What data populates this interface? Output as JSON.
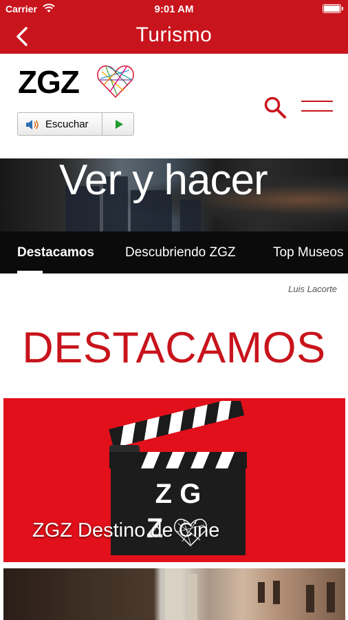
{
  "status_bar": {
    "carrier": "Carrier",
    "time": "9:01 AM"
  },
  "nav": {
    "title": "Turismo",
    "back_icon": "chevron-left-icon"
  },
  "header": {
    "logo_text": "ZGZ",
    "listen_label": "Escuchar",
    "search_icon": "search-icon",
    "menu_icon": "hamburger-menu-icon"
  },
  "banner": {
    "title": "Ver y hacer",
    "tabs": [
      {
        "label": "Destacamos",
        "active": true
      },
      {
        "label": "Descubriendo ZGZ",
        "active": false
      },
      {
        "label": "Top Museos",
        "active": false
      }
    ]
  },
  "photo_credit": "Luis Lacorte",
  "section": {
    "title": "DESTACAMOS"
  },
  "cards": [
    {
      "title": "ZGZ Destino de Cine",
      "clapper_text_line1": "Z G",
      "clapper_text_line2": "Z"
    }
  ],
  "colors": {
    "brand_red": "#c8141c",
    "card_red": "#e2101a",
    "tab_bar": "#0b0b0b"
  }
}
